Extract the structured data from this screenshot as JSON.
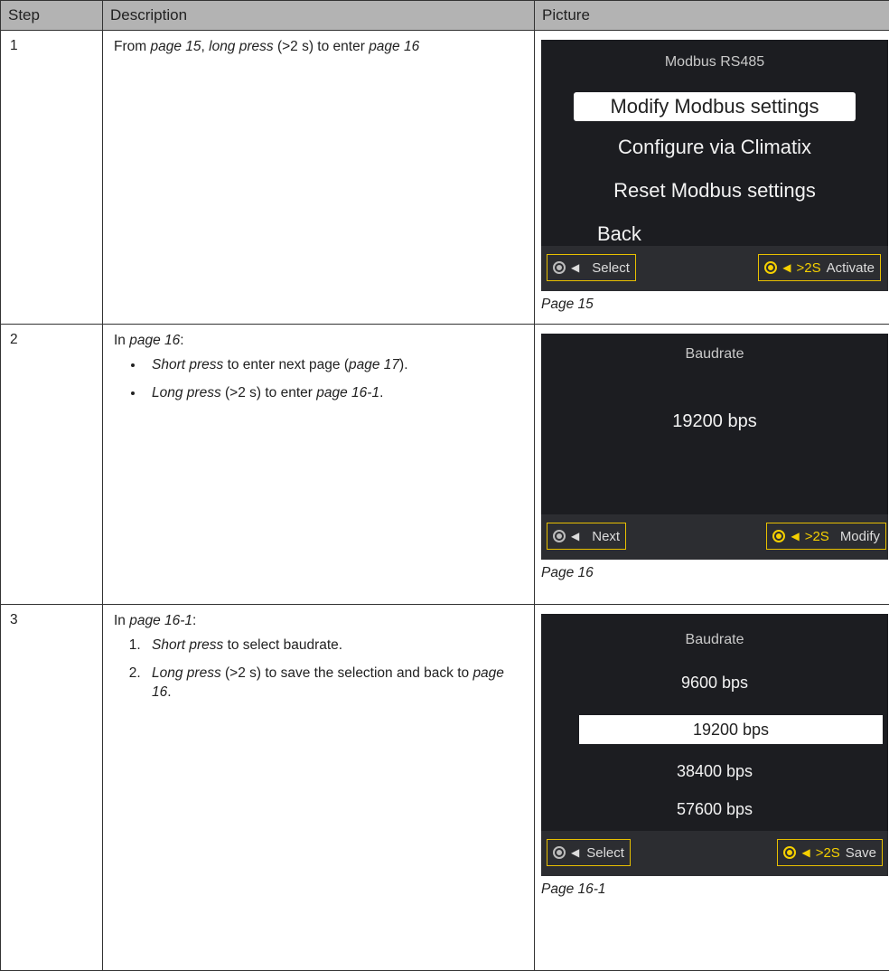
{
  "table": {
    "headers": {
      "step": "Step",
      "description": "Description",
      "picture": "Picture"
    },
    "rows": [
      {
        "step": "1",
        "desc": {
          "a": "From ",
          "b": "page 15",
          "c": ", ",
          "d": "long press",
          "e": " (>2 s) to enter ",
          "f": "page 16"
        },
        "screen": {
          "title": "Modbus RS485",
          "items": [
            "Modify Modbus settings",
            "Configure via Climatix",
            "Reset Modbus settings",
            "Back"
          ],
          "selected_index": 0,
          "left_button": "Select",
          "right_hold": ">2S",
          "right_button": "Activate"
        },
        "caption": "Page 15"
      },
      {
        "step": "2",
        "desc": {
          "intro_a": "In ",
          "intro_b": "page 16",
          "intro_c": ":",
          "bullet1": {
            "a": "Short press",
            "b": " to enter next page (",
            "c": "page 17",
            "d": ")."
          },
          "bullet2": {
            "a": "Long press",
            "b": " (>2 s) to enter ",
            "c": "page 16-1",
            "d": "."
          }
        },
        "screen": {
          "title": "Baudrate",
          "value": "19200 bps",
          "left_button": "Next",
          "right_hold": ">2S",
          "right_button": "Modify"
        },
        "caption": "Page 16"
      },
      {
        "step": "3",
        "desc": {
          "intro_a": "In ",
          "intro_b": "page 16-1",
          "intro_c": ":",
          "item1": {
            "a": "Short press",
            "b": " to select baudrate."
          },
          "item2": {
            "a": "Long press",
            "b": " (>2 s) to save the selection and back to ",
            "c": "page 16",
            "d": "."
          }
        },
        "screen": {
          "title": "Baudrate",
          "items": [
            "9600 bps",
            "19200 bps",
            "38400 bps",
            "57600 bps"
          ],
          "selected_index": 1,
          "left_button": "Select",
          "right_hold": ">2S",
          "right_button": "Save"
        },
        "caption": "Page 16-1"
      }
    ]
  },
  "colors": {
    "header_bg": "#b3b3b3",
    "screen_bg": "#1c1d21",
    "footer_bg": "#2c2d31",
    "accent_yellow": "#f5d000"
  },
  "icons": {
    "knob": "rotary-knob-icon",
    "arrow": "left-arrow-icon"
  }
}
